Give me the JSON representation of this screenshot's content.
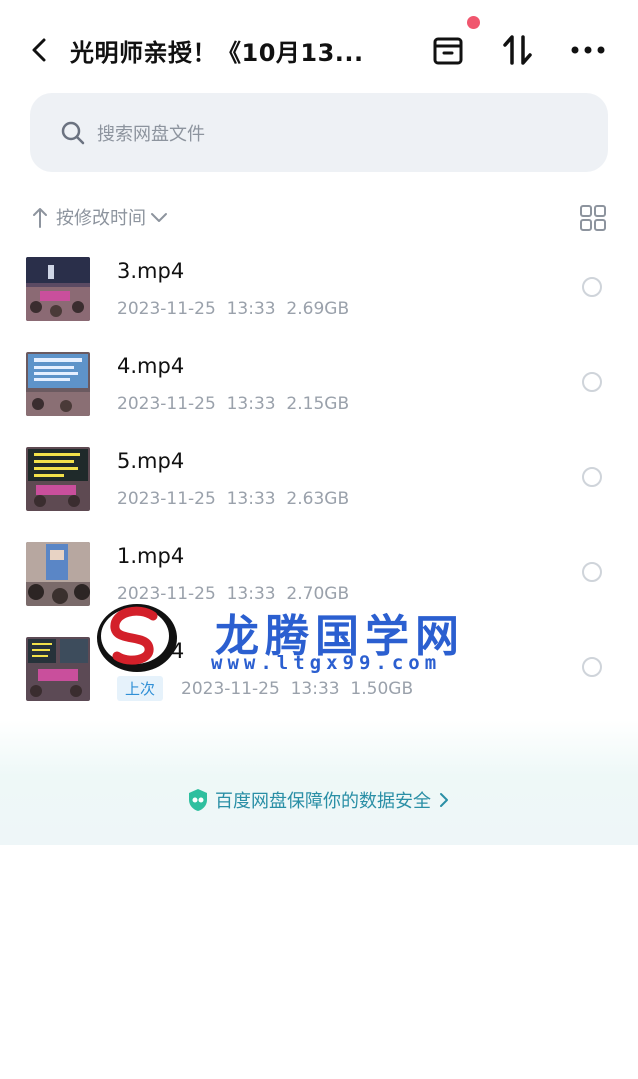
{
  "header": {
    "title": "光明师亲授！《10月13...",
    "back_icon": "chevron-left-icon",
    "archive_icon": "archive-box-icon",
    "transfer_icon": "transfer-arrows-icon",
    "more_icon": "more-dots-icon",
    "notification_color": "#f0566e"
  },
  "search": {
    "placeholder": "搜索网盘文件",
    "icon": "search-icon"
  },
  "sort": {
    "label": "按修改时间",
    "icon": "sort-arrow-up-icon",
    "dropdown_icon": "chevron-down-icon",
    "view_icon": "grid-view-icon"
  },
  "files": [
    {
      "name": "3.mp4",
      "date": "2023-11-25",
      "time": "13:33",
      "size": "2.69GB",
      "badge": ""
    },
    {
      "name": "4.mp4",
      "date": "2023-11-25",
      "time": "13:33",
      "size": "2.15GB",
      "badge": ""
    },
    {
      "name": "5.mp4",
      "date": "2023-11-25",
      "time": "13:33",
      "size": "2.63GB",
      "badge": ""
    },
    {
      "name": "1.mp4",
      "date": "2023-11-25",
      "time": "13:33",
      "size": "2.70GB",
      "badge": ""
    },
    {
      "name": "2.mp4",
      "date": "2023-11-25",
      "time": "13:33",
      "size": "1.50GB",
      "badge": "上次"
    }
  ],
  "footer": {
    "security_text": "百度网盘保障你的数据安全",
    "shield_icon": "shield-icon",
    "arrow_icon": "chevron-right-icon",
    "accent": "#2a8fa6"
  },
  "watermark": {
    "title": "龙腾国学网",
    "url": "www.ltgx99.com"
  }
}
